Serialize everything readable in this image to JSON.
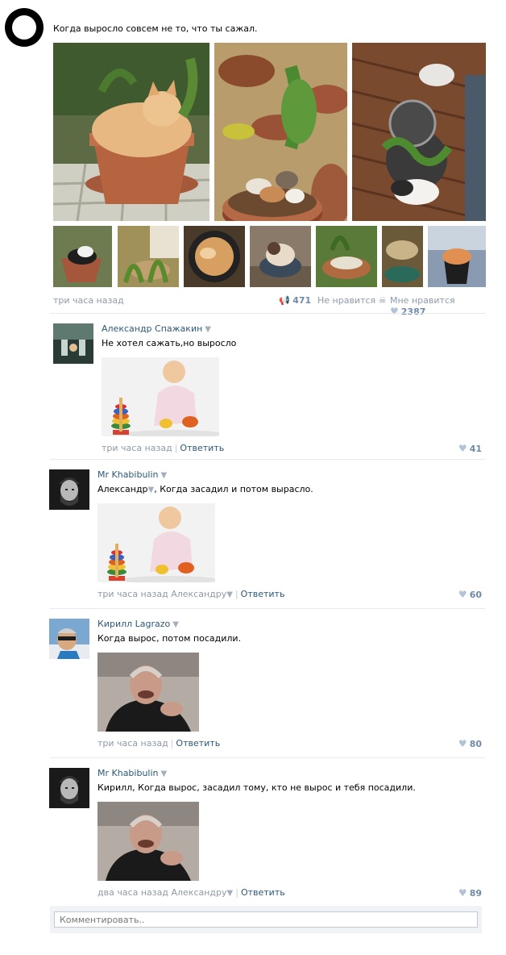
{
  "post": {
    "text": "Когда выросло совсем не то, что ты сажал.",
    "time": "три часа назад",
    "share_count": "471",
    "dislike_label": "Не нравится",
    "like_label": "Мне нравится",
    "like_count": "2387",
    "photos": [
      "cat-in-pot-photo",
      "kittens-in-pot-photo",
      "cats-in-planters-photo"
    ],
    "thumbs": [
      "cat-pot-thumb-1",
      "cat-pot-thumb-2",
      "cat-pot-thumb-3",
      "cat-pot-thumb-4",
      "cat-pot-thumb-5",
      "cat-pot-thumb-6",
      "cat-pot-thumb-7"
    ]
  },
  "comments": [
    {
      "author": "Александр Спажакин",
      "text": "Не хотел сажать,но выросло",
      "time": "три часа назад",
      "reply_to": "",
      "reply": "Ответить",
      "likes": "41"
    },
    {
      "author": "Mr Khabibulin",
      "text_mention": "Александр",
      "text": ", Когда засадил и потом вырасло.",
      "time": "три часа назад",
      "reply_to": "Александру",
      "reply": "Ответить",
      "likes": "60"
    },
    {
      "author": "Кирилл Lagrazo",
      "text": "Когда вырос, потом посадили.",
      "time": "три часа назад",
      "reply_to": "",
      "reply": "Ответить",
      "likes": "80"
    },
    {
      "author": "Mr Khabibulin",
      "text": "Кирилл, Когда вырос, засадил тому, кто не вырос и тебя посадили.",
      "time": "два часа назад",
      "reply_to": "Александру",
      "reply": "Ответить",
      "likes": "89"
    }
  ],
  "comment_input": {
    "placeholder": "Комментировать.."
  },
  "icons": {
    "share": "megaphone-icon",
    "dislike": "skull-icon",
    "like": "heart-icon",
    "author_menu": "dropdown-arrow-icon"
  },
  "colors": {
    "link": "#2b587a",
    "meta": "#8d9aa8",
    "count": "#6f8aa8",
    "separator": "#e6e9ee"
  }
}
